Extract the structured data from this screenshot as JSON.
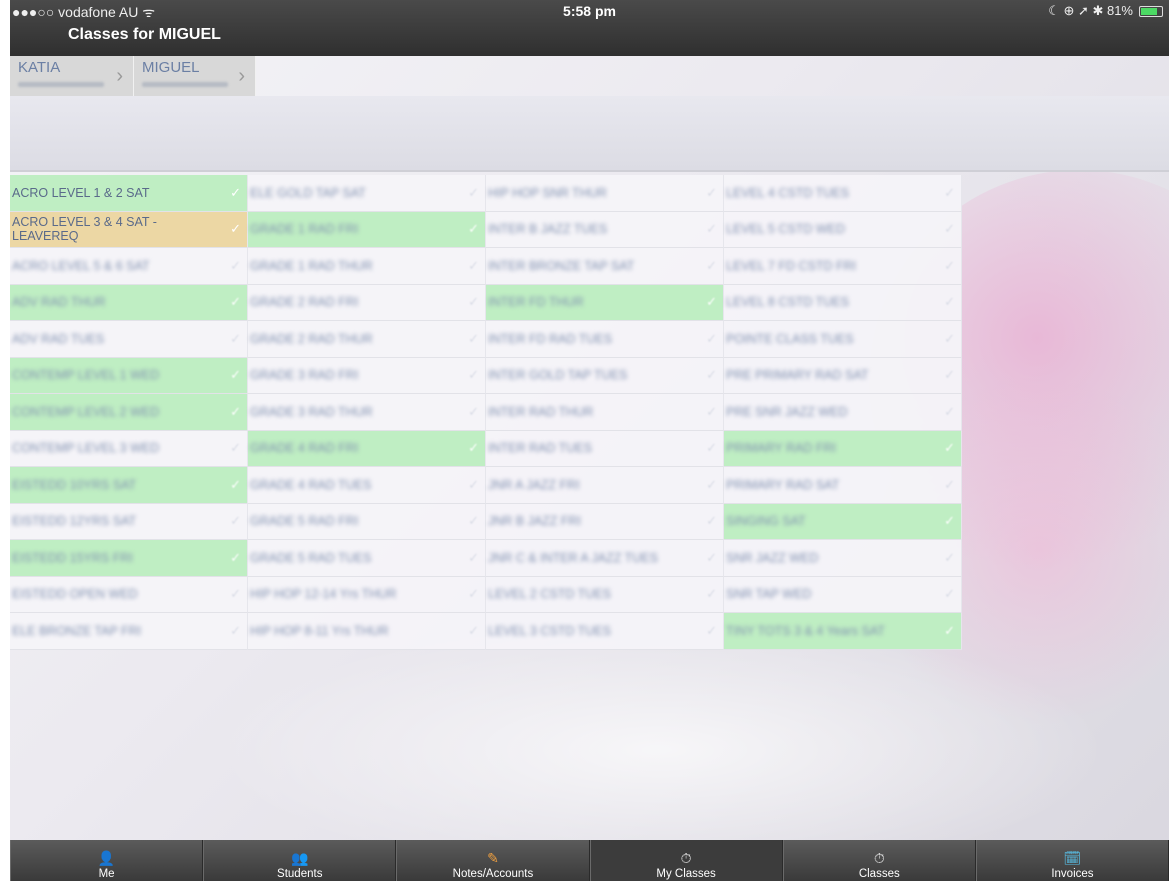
{
  "status_bar": {
    "carrier": "●●●○○ vodafone AU ᯤ",
    "time": "5:58 pm",
    "indicators": "☾ ⊕ ➚ ✱ 81%",
    "battery_level": 0.81
  },
  "nav": {
    "title": "Classes for MIGUEL"
  },
  "breadcrumb": [
    {
      "name": "KATIA"
    },
    {
      "name": "MIGUEL"
    }
  ],
  "columns": [
    [
      {
        "label": "ACRO LEVEL 1 & 2 SAT",
        "state": "enrolled",
        "blurred": false
      },
      {
        "label": "ACRO LEVEL 3 & 4 SAT - LEAVEREQ",
        "state": "pending",
        "blurred": false
      },
      {
        "label": "ACRO LEVEL 5 & 6 SAT",
        "state": "none",
        "blurred": true
      },
      {
        "label": "ADV RAD THUR",
        "state": "enrolled",
        "blurred": true
      },
      {
        "label": "ADV RAD TUES",
        "state": "none",
        "blurred": true
      },
      {
        "label": "CONTEMP LEVEL 1 WED",
        "state": "enrolled",
        "blurred": true
      },
      {
        "label": "CONTEMP LEVEL 2 WED",
        "state": "enrolled",
        "blurred": true
      },
      {
        "label": "CONTEMP LEVEL 3 WED",
        "state": "none",
        "blurred": true
      },
      {
        "label": "EISTEDD 10YRS SAT",
        "state": "enrolled",
        "blurred": true
      },
      {
        "label": "EISTEDD 12YRS SAT",
        "state": "none",
        "blurred": true
      },
      {
        "label": "EISTEDD 15YRS FRI",
        "state": "enrolled",
        "blurred": true
      },
      {
        "label": "EISTEDD OPEN WED",
        "state": "none",
        "blurred": true
      },
      {
        "label": "ELE BRONZE TAP FRI",
        "state": "none",
        "blurred": true
      }
    ],
    [
      {
        "label": "ELE GOLD TAP SAT",
        "state": "none",
        "blurred": true
      },
      {
        "label": "GRADE 1 RAD FRI",
        "state": "enrolled",
        "blurred": true
      },
      {
        "label": "GRADE 1 RAD THUR",
        "state": "none",
        "blurred": true
      },
      {
        "label": "GRADE 2 RAD FRI",
        "state": "none",
        "blurred": true
      },
      {
        "label": "GRADE 2 RAD THUR",
        "state": "none",
        "blurred": true
      },
      {
        "label": "GRADE 3 RAD FRI",
        "state": "none",
        "blurred": true
      },
      {
        "label": "GRADE 3 RAD THUR",
        "state": "none",
        "blurred": true
      },
      {
        "label": "GRADE 4 RAD FRI",
        "state": "enrolled",
        "blurred": true
      },
      {
        "label": "GRADE 4 RAD TUES",
        "state": "none",
        "blurred": true
      },
      {
        "label": "GRADE 5 RAD FRI",
        "state": "none",
        "blurred": true
      },
      {
        "label": "GRADE 5 RAD TUES",
        "state": "none",
        "blurred": true
      },
      {
        "label": "HIP HOP 12-14 Yrs THUR",
        "state": "none",
        "blurred": true
      },
      {
        "label": "HIP HOP 8-11 Yrs THUR",
        "state": "none",
        "blurred": true
      }
    ],
    [
      {
        "label": "HIP HOP SNR THUR",
        "state": "none",
        "blurred": true
      },
      {
        "label": "INTER B JAZZ TUES",
        "state": "none",
        "blurred": true
      },
      {
        "label": "INTER BRONZE TAP SAT",
        "state": "none",
        "blurred": true
      },
      {
        "label": "INTER FD THUR",
        "state": "enrolled",
        "blurred": true
      },
      {
        "label": "INTER FD RAD TUES",
        "state": "none",
        "blurred": true
      },
      {
        "label": "INTER GOLD TAP TUES",
        "state": "none",
        "blurred": true
      },
      {
        "label": "INTER RAD THUR",
        "state": "none",
        "blurred": true
      },
      {
        "label": "INTER RAD TUES",
        "state": "none",
        "blurred": true
      },
      {
        "label": "JNR A JAZZ FRI",
        "state": "none",
        "blurred": true
      },
      {
        "label": "JNR B JAZZ FRI",
        "state": "none",
        "blurred": true
      },
      {
        "label": "JNR C & INTER A JAZZ TUES",
        "state": "none",
        "blurred": true
      },
      {
        "label": "LEVEL 2 CSTD TUES",
        "state": "none",
        "blurred": true
      },
      {
        "label": "LEVEL 3 CSTD TUES",
        "state": "none",
        "blurred": true
      }
    ],
    [
      {
        "label": "LEVEL 4 CSTD TUES",
        "state": "none",
        "blurred": true
      },
      {
        "label": "LEVEL 5 CSTD WED",
        "state": "none",
        "blurred": true
      },
      {
        "label": "LEVEL 7 FD CSTD FRI",
        "state": "none",
        "blurred": true
      },
      {
        "label": "LEVEL 8 CSTD TUES",
        "state": "none",
        "blurred": true
      },
      {
        "label": "POINTE CLASS TUES",
        "state": "none",
        "blurred": true
      },
      {
        "label": "PRE PRIMARY RAD SAT",
        "state": "none",
        "blurred": true
      },
      {
        "label": "PRE SNR JAZZ WED",
        "state": "none",
        "blurred": true
      },
      {
        "label": "PRIMARY RAD FRI",
        "state": "enrolled",
        "blurred": true
      },
      {
        "label": "PRIMARY RAD SAT",
        "state": "none",
        "blurred": true
      },
      {
        "label": "SINGING SAT",
        "state": "enrolled",
        "blurred": true
      },
      {
        "label": "SNR JAZZ WED",
        "state": "none",
        "blurred": true
      },
      {
        "label": "SNR TAP WED",
        "state": "none",
        "blurred": true
      },
      {
        "label": "TINY TOTS 3 & 4 Years SAT",
        "state": "enrolled",
        "blurred": true
      }
    ]
  ],
  "tabs": [
    {
      "label": "Me",
      "icon": "person-icon",
      "glyph": "👤",
      "active": false
    },
    {
      "label": "Students",
      "icon": "students-icon",
      "glyph": "👥",
      "active": false
    },
    {
      "label": "Notes/Accounts",
      "icon": "notes-icon",
      "glyph": "✎",
      "active": false
    },
    {
      "label": "My Classes",
      "icon": "stopwatch-icon",
      "glyph": "⏱",
      "active": true
    },
    {
      "label": "Classes",
      "icon": "stopwatch-icon",
      "glyph": "⏱",
      "active": false
    },
    {
      "label": "Invoices",
      "icon": "invoice-icon",
      "glyph": "🗓",
      "active": false
    }
  ],
  "colors": {
    "enrolled": "#bfeec3",
    "pending": "#ecd7a4",
    "bar": "#3a3a3a"
  }
}
